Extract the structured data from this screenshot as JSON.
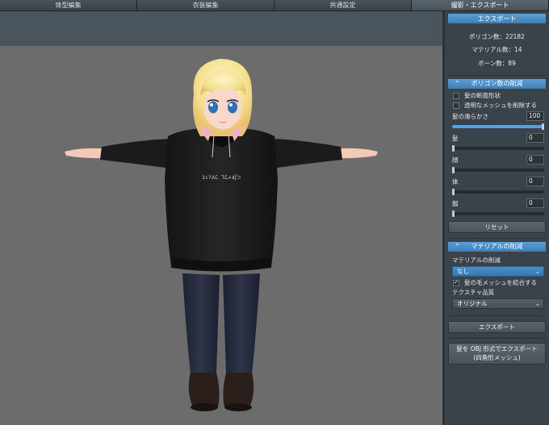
{
  "tabs": [
    {
      "label": "体型編集"
    },
    {
      "label": "衣装編集"
    },
    {
      "label": "共通設定"
    },
    {
      "label": "撮影・エクスポート"
    }
  ],
  "export_panel": {
    "title": "エクスポート",
    "polygon_count_label": "ポリゴン数：22182",
    "material_count_label": "マテリアル数：14",
    "bone_count_label": "ボーン数：89"
  },
  "polygon_reduction": {
    "title": "ポリゴン数の削減",
    "hair_cross_section": {
      "label": "髪の断面形状",
      "checked": false
    },
    "remove_transparent": {
      "label": "透明なメッシュを削除する",
      "checked": false
    },
    "hair_smoothness": {
      "label": "髪の滑らかさ",
      "value": "100",
      "level": 1.0
    },
    "hair": {
      "label": "髪",
      "value": "0",
      "level": 0
    },
    "face": {
      "label": "顔",
      "value": "0",
      "level": 0
    },
    "body": {
      "label": "体",
      "value": "0",
      "level": 0
    },
    "clothes": {
      "label": "服",
      "value": "0",
      "level": 0
    },
    "reset_label": "リセット"
  },
  "material_reduction": {
    "title": "マテリアルの削減",
    "reduction_label": "マテリアルの削減",
    "reduction_value": "なし",
    "merge_hair": {
      "label": "髪の毛メッシュを結合する",
      "checked": true
    },
    "texture_quality_label": "テクスチャ品質",
    "texture_quality_value": "オリジナル"
  },
  "actions": {
    "export_label": "エクスポート",
    "obj_export_line1": "髪を OBJ 形式でエクスポート",
    "obj_export_line2": "(四角形メッシュ)"
  },
  "hoodie_text": "1ι?∂ℒ ⅂ℒ∠Ⅎ∫⊃"
}
